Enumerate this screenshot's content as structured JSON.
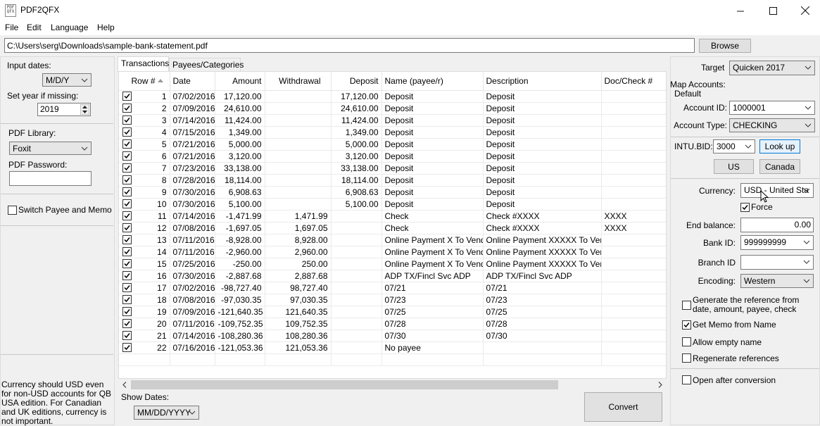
{
  "window": {
    "title": "PDF2QFX",
    "icon_text": "PDF QFX"
  },
  "menu": {
    "file": "File",
    "edit": "Edit",
    "language": "Language",
    "help": "Help"
  },
  "path": {
    "value": "C:\\Users\\serg\\Downloads\\sample-bank-statement.pdf",
    "browse_label": "Browse"
  },
  "left": {
    "input_dates_label": "Input dates:",
    "input_dates_value": "M/D/Y",
    "set_year_label": "Set year if missing:",
    "set_year_value": "2019",
    "pdf_library_label": "PDF Library:",
    "pdf_library_value": "Foxit",
    "pdf_password_label": "PDF Password:",
    "pdf_password_value": "",
    "switch_payee_label": "Switch Payee and Memo",
    "note": "Currency should USD even for non-USD accounts for QB USA edition. For Canadian and UK editions, currency is not important."
  },
  "tabs": {
    "transactions": "Transactions",
    "payees": "Payees/Categories"
  },
  "table": {
    "columns": [
      "Row #",
      "Date",
      "Amount",
      "Withdrawal",
      "Deposit",
      "Name (payee/r)",
      "Description",
      "Doc/Check #"
    ],
    "rows": [
      [
        "1",
        "07/02/2016",
        "17,120.00",
        "",
        "17,120.00",
        "Deposit",
        "Deposit",
        ""
      ],
      [
        "2",
        "07/09/2016",
        "24,610.00",
        "",
        "24,610.00",
        "Deposit",
        "Deposit",
        ""
      ],
      [
        "3",
        "07/14/2016",
        "11,424.00",
        "",
        "11,424.00",
        "Deposit",
        "Deposit",
        ""
      ],
      [
        "4",
        "07/15/2016",
        "1,349.00",
        "",
        "1,349.00",
        "Deposit",
        "Deposit",
        ""
      ],
      [
        "5",
        "07/21/2016",
        "5,000.00",
        "",
        "5,000.00",
        "Deposit",
        "Deposit",
        ""
      ],
      [
        "6",
        "07/21/2016",
        "3,120.00",
        "",
        "3,120.00",
        "Deposit",
        "Deposit",
        ""
      ],
      [
        "7",
        "07/23/2016",
        "33,138.00",
        "",
        "33,138.00",
        "Deposit",
        "Deposit",
        ""
      ],
      [
        "8",
        "07/28/2016",
        "18,114.00",
        "",
        "18,114.00",
        "Deposit",
        "Deposit",
        ""
      ],
      [
        "9",
        "07/30/2016",
        "6,908.63",
        "",
        "6,908.63",
        "Deposit",
        "Deposit",
        ""
      ],
      [
        "10",
        "07/30/2016",
        "5,100.00",
        "",
        "5,100.00",
        "Deposit",
        "Deposit",
        ""
      ],
      [
        "11",
        "07/14/2016",
        "-1,471.99",
        "1,471.99",
        "",
        "Check",
        "Check #XXXX",
        "XXXX"
      ],
      [
        "12",
        "07/08/2016",
        "-1,697.05",
        "1,697.05",
        "",
        "Check",
        "Check #XXXX",
        "XXXX"
      ],
      [
        "13",
        "07/11/2016",
        "-8,928.00",
        "8,928.00",
        "",
        "Online Payment X To Vendor",
        "Online Payment XXXXX To Vendor",
        ""
      ],
      [
        "14",
        "07/11/2016",
        "-2,960.00",
        "2,960.00",
        "",
        "Online Payment X To Vendor",
        "Online Payment XXXXX To Vendor",
        ""
      ],
      [
        "15",
        "07/25/2016",
        "-250.00",
        "250.00",
        "",
        "Online Payment X To Vendor",
        "Online Payment XXXXX To Vendor",
        ""
      ],
      [
        "16",
        "07/30/2016",
        "-2,887.68",
        "2,887.68",
        "",
        "ADP TX/Fincl Svc ADP",
        "ADP TX/Fincl Svc ADP",
        ""
      ],
      [
        "17",
        "07/02/2016",
        "-98,727.40",
        "98,727.40",
        "",
        "07/21",
        "07/21",
        ""
      ],
      [
        "18",
        "07/08/2016",
        "-97,030.35",
        "97,030.35",
        "",
        "07/23",
        "07/23",
        ""
      ],
      [
        "19",
        "07/09/2016",
        "-121,640.35",
        "121,640.35",
        "",
        "07/25",
        "07/25",
        ""
      ],
      [
        "20",
        "07/11/2016",
        "-109,752.35",
        "109,752.35",
        "",
        "07/28",
        "07/28",
        ""
      ],
      [
        "21",
        "07/14/2016",
        "-108,280.36",
        "108,280.36",
        "",
        "07/30",
        "07/30",
        ""
      ],
      [
        "22",
        "07/16/2016",
        "-121,053.36",
        "121,053.36",
        "",
        "No payee",
        "",
        ""
      ]
    ]
  },
  "bottom": {
    "show_dates_label": "Show Dates:",
    "show_dates_value": "MM/DD/YYYY",
    "convert_label": "Convert"
  },
  "right": {
    "target_label": "Target",
    "target_value": "Quicken 2017",
    "map_accounts_label": "Map Accounts:",
    "default_label": "Default",
    "account_id_label": "Account ID:",
    "account_id_value": "1000001",
    "account_type_label": "Account Type:",
    "account_type_value": "CHECKING",
    "intu_bid_label": "INTU.BID:",
    "intu_bid_value": "3000",
    "lookup_label": "Look up",
    "us_label": "US",
    "canada_label": "Canada",
    "currency_label": "Currency:",
    "currency_value": "USD - United Sta",
    "force_label": "Force",
    "end_balance_label": "End balance:",
    "end_balance_value": "0.00",
    "bank_id_label": "Bank ID:",
    "bank_id_value": "999999999",
    "branch_id_label": "Branch ID",
    "branch_id_value": "",
    "encoding_label": "Encoding:",
    "encoding_value": "Western",
    "generate_ref_label": "Generate the reference from date, amount, payee, check",
    "get_memo_label": "Get Memo from Name",
    "allow_empty_label": "Allow empty name",
    "regenerate_label": "Regenerate references",
    "open_after_label": "Open after conversion"
  },
  "colors": {
    "focus_border": "#0078d7",
    "scroll_thumb": "#cdcdcd"
  }
}
